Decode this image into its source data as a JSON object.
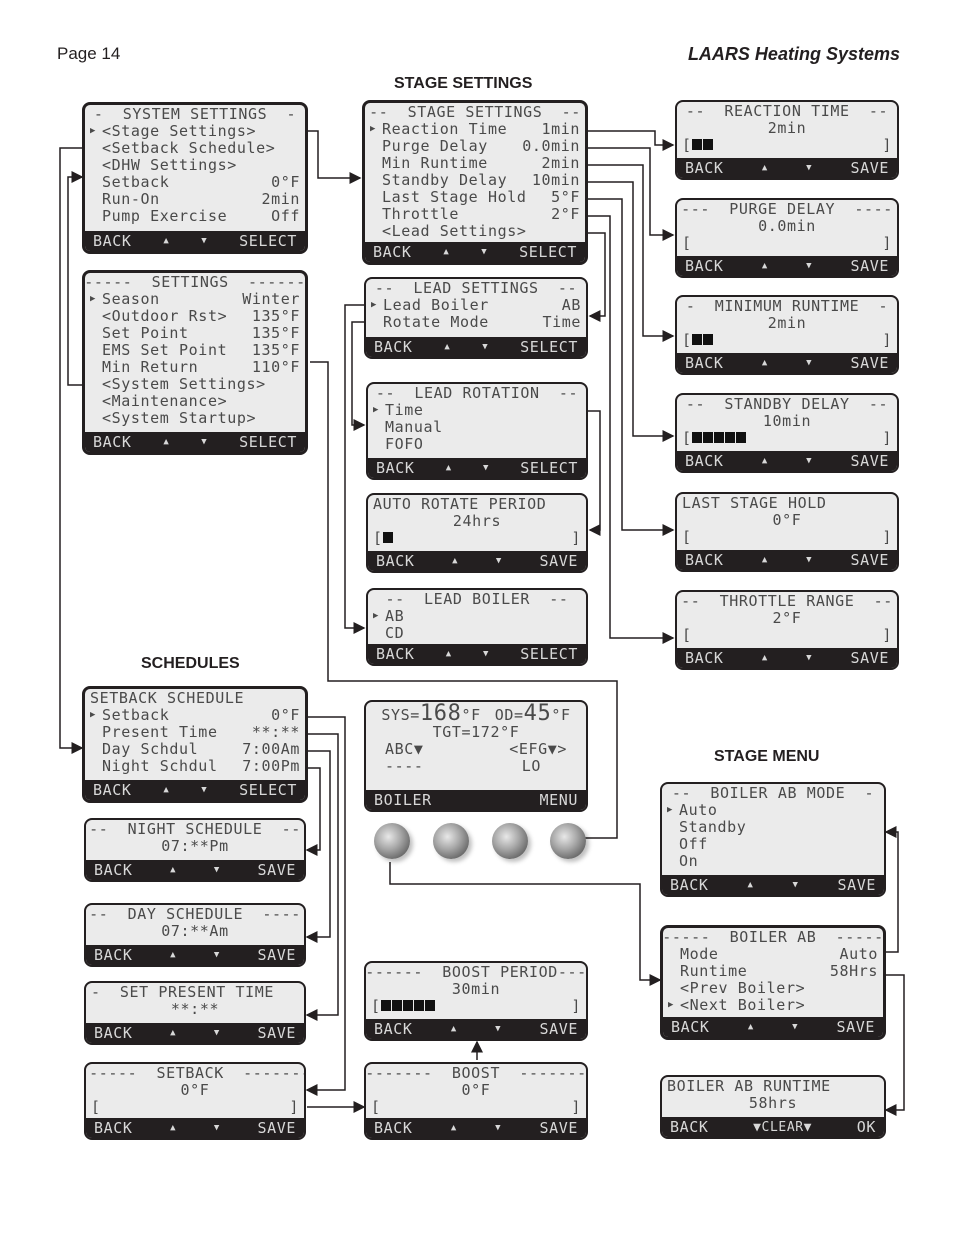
{
  "header": {
    "page": "Page 14",
    "brand": "LAARS Heating Systems"
  },
  "sections": {
    "stage_settings": "STAGE SETTINGS",
    "schedules": "SCHEDULES",
    "stage_menu": "STAGE MENU"
  },
  "softkeys": {
    "back": "BACK",
    "select": "SELECT",
    "save": "SAVE",
    "up": "▲",
    "down": "▼",
    "ok": "OK",
    "clear": "▼CLEAR▼",
    "boiler": "BOILER",
    "menu": "MENU",
    "cursor": "▶"
  },
  "system_settings": {
    "title": "-  SYSTEM SETTINGS  -",
    "items": [
      {
        "label": "<Stage Settings>",
        "value": ""
      },
      {
        "label": "<Setback Schedule>",
        "value": ""
      },
      {
        "label": "<DHW Settings>",
        "value": ""
      },
      {
        "label": "Setback",
        "value": "0°F"
      },
      {
        "label": "Run-On",
        "value": "2min"
      },
      {
        "label": "Pump Exercise",
        "value": "Off"
      }
    ]
  },
  "settings": {
    "title": "-----  SETTINGS  ------",
    "items": [
      {
        "label": "Season",
        "value": "Winter"
      },
      {
        "label": "<Outdoor Rst>",
        "value": "135°F"
      },
      {
        "label": "Set Point",
        "value": "135°F"
      },
      {
        "label": "EMS Set Point",
        "value": "135°F"
      },
      {
        "label": "Min Return",
        "value": "110°F"
      },
      {
        "label": "<System Settings>",
        "value": ""
      },
      {
        "label": "<Maintenance>",
        "value": ""
      },
      {
        "label": "<System Startup>",
        "value": ""
      }
    ]
  },
  "stage_settings": {
    "title": "--  STAGE SETTINGS  --",
    "items": [
      {
        "label": "Reaction Time",
        "value": "1min"
      },
      {
        "label": "Purge Delay",
        "value": "0.0min"
      },
      {
        "label": "Min Runtime",
        "value": "2min"
      },
      {
        "label": "Standby Delay",
        "value": "10min"
      },
      {
        "label": "Last Stage Hold",
        "value": "5°F"
      },
      {
        "label": "Throttle",
        "value": "2°F"
      },
      {
        "label": "<Lead Settings>",
        "value": ""
      }
    ]
  },
  "lead_settings": {
    "title": "--  LEAD SETTINGS  --",
    "items": [
      {
        "label": "Lead Boiler",
        "value": "AB"
      },
      {
        "label": "Rotate Mode",
        "value": "Time"
      }
    ]
  },
  "lead_rotation": {
    "title": "--  LEAD ROTATION  --",
    "options": [
      "Time",
      "Manual",
      "FOFO"
    ]
  },
  "auto_rotate_period": {
    "title": "AUTO ROTATE PERIOD",
    "value": "24hrs",
    "level_blocks": 1
  },
  "lead_boiler": {
    "title": "--  LEAD BOILER  --",
    "options": [
      "AB",
      "CD"
    ]
  },
  "reaction_time": {
    "title": "--  REACTION TIME  --",
    "value": "2min",
    "level_blocks": 2
  },
  "purge_delay": {
    "title": "---  PURGE DELAY  ----",
    "value": "0.0min",
    "level_blocks": 0
  },
  "minimum_runtime": {
    "title": "-  MINIMUM RUNTIME  -",
    "value": "2min",
    "level_blocks": 2
  },
  "standby_delay": {
    "title": "--  STANDBY DELAY  --",
    "value": "10min",
    "level_blocks": 5
  },
  "last_stage_hold": {
    "title": "LAST STAGE HOLD",
    "value": "0°F",
    "level_blocks": 0
  },
  "throttle_range": {
    "title": "--  THROTTLE RANGE  --",
    "value": "2°F",
    "level_blocks": 0
  },
  "setback_schedule": {
    "title": "SETBACK SCHEDULE",
    "items": [
      {
        "label": "Setback",
        "value": "0°F"
      },
      {
        "label": "Present Time",
        "value": "**:**"
      },
      {
        "label": "Day Schdul",
        "value": "7:00Am"
      },
      {
        "label": "Night Schdul",
        "value": "7:00Pm"
      }
    ]
  },
  "night_schedule": {
    "title": "--  NIGHT SCHEDULE  --",
    "value": "07:**Pm"
  },
  "day_schedule": {
    "title": "--  DAY SCHEDULE  ----",
    "value": "07:**Am"
  },
  "set_present_time": {
    "title": "-  SET PRESENT TIME",
    "value": "**:**"
  },
  "setback": {
    "title": "------  SETBACK  -------",
    "value": "0°F",
    "level_blocks": 0
  },
  "home_screen": {
    "sys_label": "SYS=",
    "sys_value": "168",
    "sys_unit": "°F",
    "od_label": "OD=",
    "od_value": "45",
    "od_unit": "°F",
    "tgt": "TGT=172°F",
    "left_group": "ABC▼",
    "right_group": "<EFG▼>",
    "left_status": "----",
    "right_status": "LO"
  },
  "boost_period": {
    "title": "------  BOOST PERIOD---",
    "value": "30min",
    "level_blocks": 5
  },
  "boost": {
    "title": "--------  BOOST  --------",
    "value": "0°F",
    "level_blocks": 0
  },
  "boiler_mode": {
    "title": "--  BOILER AB MODE  -",
    "options": [
      "Auto",
      "Standby",
      "Off",
      "On"
    ]
  },
  "boiler_ab": {
    "title": "-----  BOILER AB  -----",
    "items": [
      {
        "label": "Mode",
        "value": "Auto"
      },
      {
        "label": "Runtime",
        "value": "58Hrs"
      },
      {
        "label": "<Prev Boiler>",
        "value": ""
      },
      {
        "label": "<Next Boiler>",
        "value": ""
      }
    ]
  },
  "boiler_runtime": {
    "title": "BOILER AB RUNTIME",
    "value": "58hrs"
  },
  "colors": {
    "lcd_bg": "#ebebeb",
    "lcd_text": "#4a4a4a",
    "frame": "#231f20",
    "footer_text": "#d8d8d8"
  }
}
